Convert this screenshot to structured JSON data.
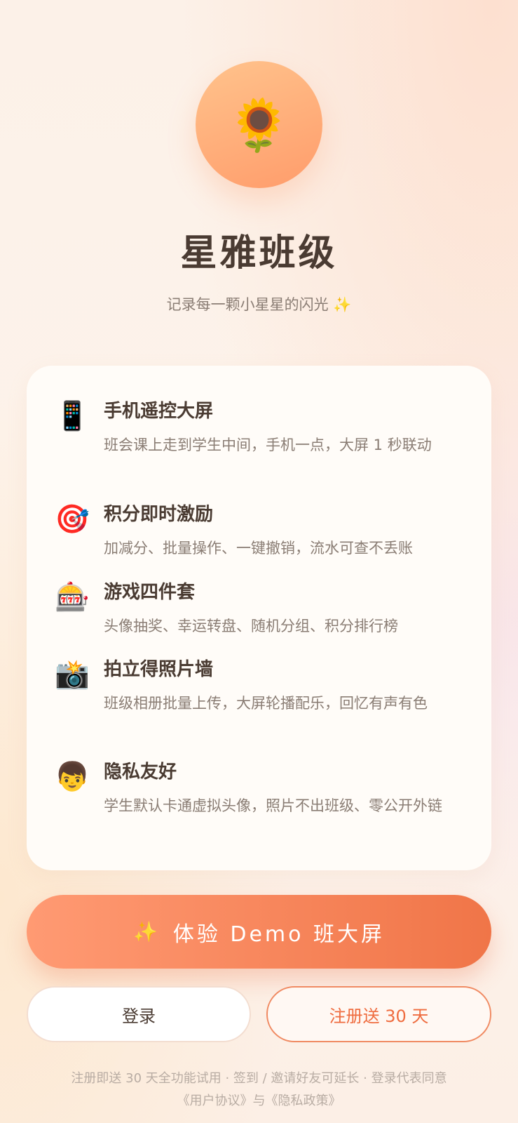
{
  "app": {
    "logo_icon": "sunflower-icon",
    "logo_glyph": "🌻",
    "title": "星雅班级",
    "subtitle": "记录每一颗小星星的闪光 ✨"
  },
  "features": [
    {
      "icon": "mobile-phone-icon",
      "glyph": "📱",
      "title": "手机遥控大屏",
      "desc": "班会课上走到学生中间，手机一点，大屏 1 秒联动"
    },
    {
      "icon": "target-icon",
      "glyph": "🎯",
      "title": "积分即时激励",
      "desc": "加减分、批量操作、一键撤销，流水可查不丢账"
    },
    {
      "icon": "slot-machine-icon",
      "glyph": "🎰",
      "title": "游戏四件套",
      "desc": "头像抽奖、幸运转盘、随机分组、积分排行榜"
    },
    {
      "icon": "camera-flash-icon",
      "glyph": "📸",
      "title": "拍立得照片墙",
      "desc": "班级相册批量上传，大屏轮播配乐，回忆有声有色"
    },
    {
      "icon": "child-avatar-icon",
      "glyph": "👦",
      "title": "隐私友好",
      "desc": "学生默认卡通虚拟头像，照片不出班级、零公开外链"
    }
  ],
  "actions": {
    "demo_sparkle": "✨",
    "demo_label": "体验 Demo 班大屏",
    "login_label": "登录",
    "register_label": "注册送 30 天"
  },
  "footer": {
    "line1": "注册即送 30 天全功能试用 · 签到 / 邀请好友可延长 · 登录代表同意",
    "user_agreement": "《用户协议》",
    "conjunction": "与",
    "privacy_policy": "《隐私政策》"
  },
  "colors": {
    "accent": "#F07548",
    "accent_light": "#FF9A73",
    "text_primary": "#4A3B32",
    "text_secondary": "#8A7D74",
    "footer_text": "#B8ACA3"
  }
}
